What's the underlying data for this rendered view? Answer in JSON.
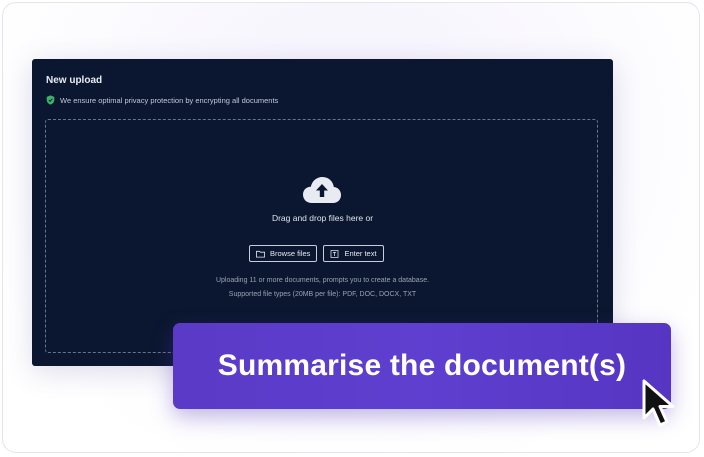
{
  "upload": {
    "title": "New upload",
    "privacy_note": "We ensure optimal privacy protection by encrypting all documents",
    "drag_text": "Drag and drop files here or",
    "browse_label": "Browse files",
    "enter_text_label": "Enter text",
    "info_line1": "Uploading 11 or more documents, prompts you to create a database.",
    "info_line2": "Supported file types (20MB per file): PDF, DOC, DOCX, TXT"
  },
  "action": {
    "label": "Summarise the document(s)"
  },
  "colors": {
    "panel_bg": "#0b1730",
    "accent_purple": "#5a3ac6",
    "shield_green": "#3fb26a"
  },
  "icons": [
    "shield-icon",
    "cloud-upload-icon",
    "folder-icon",
    "text-icon",
    "cursor-icon"
  ]
}
